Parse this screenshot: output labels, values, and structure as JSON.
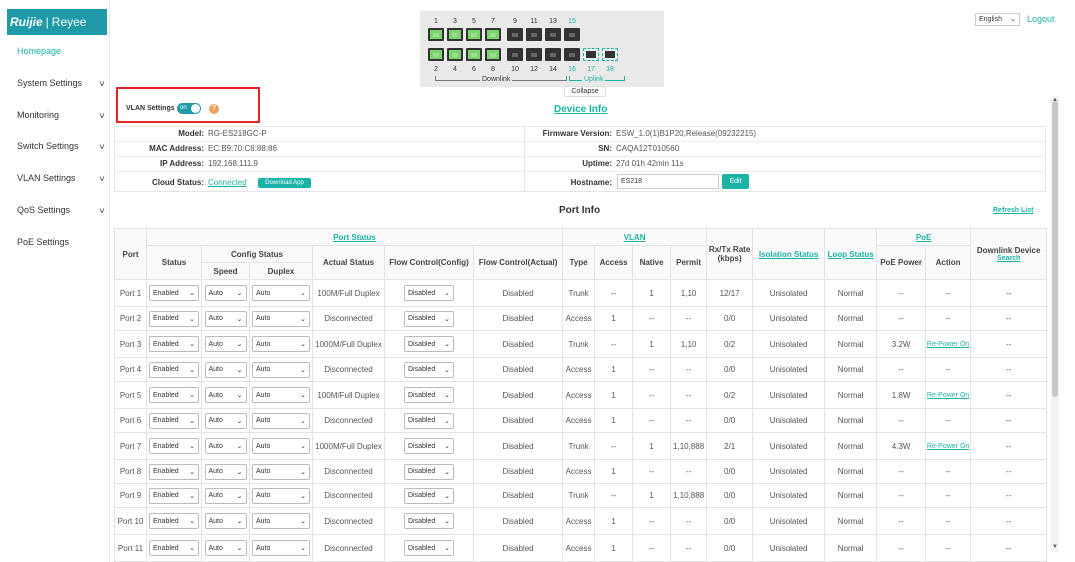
{
  "brand": {
    "logo_left": "Ruijie",
    "logo_right": "Reyee"
  },
  "sidebar": {
    "items": [
      {
        "label": "Homepage",
        "has_chevron": false,
        "active": true
      },
      {
        "label": "System Settings",
        "has_chevron": true
      },
      {
        "label": "Monitoring",
        "has_chevron": true
      },
      {
        "label": "Switch Settings",
        "has_chevron": true
      },
      {
        "label": "VLAN Settings",
        "has_chevron": true
      },
      {
        "label": "QoS Settings",
        "has_chevron": true
      },
      {
        "label": "PoE Settings",
        "has_chevron": false
      }
    ]
  },
  "panel": {
    "top_numbers": [
      "1",
      "3",
      "5",
      "7",
      "9",
      "11",
      "13",
      "15"
    ],
    "bottom_numbers": [
      "2",
      "4",
      "6",
      "8",
      "10",
      "12",
      "14",
      "16",
      "17",
      "18"
    ],
    "downlink_label": "Downlink",
    "uplink_label": "Uplink",
    "collapse_label": "Collapse"
  },
  "header": {
    "language": "English",
    "logout": "Logout"
  },
  "vlan": {
    "label": "VLAN Settings",
    "toggle": "on",
    "help": "?"
  },
  "device": {
    "title": "Device Info",
    "model_k": "Model:",
    "model": "RG-ES218GC-P",
    "mac_k": "MAC Address:",
    "mac": "EC:B9:70:C6:88:86",
    "ip_k": "IP Address:",
    "ip": "192.168.111.9",
    "cloud_k": "Cloud Status:",
    "cloud": "Connected",
    "download": "Download App",
    "fw_k": "Firmware Version:",
    "fw": "ESW_1.0(1)B1P20,Release(09232215)",
    "sn_k": "SN:",
    "sn": "CAQA12T010560",
    "uptime_k": "Uptime:",
    "uptime": "27d 01h 42min 11s",
    "host_k": "Hostname:",
    "host": "ES218",
    "edit": "Edit"
  },
  "port_info": {
    "title": "Port Info",
    "refresh": "Refresh List",
    "headers": {
      "port": "Port",
      "port_status": "Port Status",
      "status": "Status",
      "config_status": "Config Status",
      "speed": "Speed",
      "duplex": "Duplex",
      "actual_status": "Actual Status",
      "flow_config": "Flow Control(Config)",
      "flow_actual": "Flow Control(Actual)",
      "vlan": "VLAN",
      "type": "Type",
      "access": "Access",
      "native": "Native",
      "permit": "Permit",
      "rxtx": "Rx/Tx Rate (kbps)",
      "isolation": "Isolation Status",
      "loop": "Loop Status",
      "poe": "PoE",
      "poe_power": "PoE Power",
      "action": "Action",
      "downlink": "Downlink Device",
      "search": "Search"
    },
    "rows": [
      {
        "port": "Port 1",
        "status": "Enabled",
        "speed": "Auto",
        "duplex": "Auto",
        "actual": "100M/Full Duplex",
        "actual_link": true,
        "flow_cfg": "Disabled",
        "flow_act": "Disabled",
        "type": "Trunk",
        "access": "--",
        "native": "1",
        "permit": "1,10",
        "rate": "12/17",
        "iso": "Unisolated",
        "loop": "Normal",
        "power": "--",
        "action": "--",
        "action_link": false,
        "dev": "--"
      },
      {
        "port": "Port 2",
        "status": "Enabled",
        "speed": "Auto",
        "duplex": "Auto",
        "actual": "Disconnected",
        "actual_link": false,
        "flow_cfg": "Disabled",
        "flow_act": "Disabled",
        "type": "Access",
        "access": "1",
        "native": "--",
        "permit": "--",
        "rate": "0/0",
        "iso": "Unisolated",
        "loop": "Normal",
        "power": "--",
        "action": "--",
        "action_link": false,
        "dev": "--"
      },
      {
        "port": "Port 3",
        "status": "Enabled",
        "speed": "Auto",
        "duplex": "Auto",
        "actual": "1000M/Full Duplex",
        "actual_link": true,
        "flow_cfg": "Disabled",
        "flow_act": "Disabled",
        "type": "Trunk",
        "access": "--",
        "native": "1",
        "permit": "1,10",
        "rate": "0/2",
        "iso": "Unisolated",
        "loop": "Normal",
        "power": "3.2W",
        "action": "Re-Power On",
        "action_link": true,
        "dev": "--"
      },
      {
        "port": "Port 4",
        "status": "Enabled",
        "speed": "Auto",
        "duplex": "Auto",
        "actual": "Disconnected",
        "actual_link": false,
        "flow_cfg": "Disabled",
        "flow_act": "Disabled",
        "type": "Access",
        "access": "1",
        "native": "--",
        "permit": "--",
        "rate": "0/0",
        "iso": "Unisolated",
        "loop": "Normal",
        "power": "--",
        "action": "--",
        "action_link": false,
        "dev": "--"
      },
      {
        "port": "Port 5",
        "status": "Enabled",
        "speed": "Auto",
        "duplex": "Auto",
        "actual": "100M/Full Duplex",
        "actual_link": true,
        "flow_cfg": "Disabled",
        "flow_act": "Disabled",
        "type": "Access",
        "access": "1",
        "native": "--",
        "permit": "--",
        "rate": "0/2",
        "iso": "Unisolated",
        "loop": "Normal",
        "power": "1.8W",
        "action": "Re-Power On",
        "action_link": true,
        "dev": "--"
      },
      {
        "port": "Port 6",
        "status": "Enabled",
        "speed": "Auto",
        "duplex": "Auto",
        "actual": "Disconnected",
        "actual_link": false,
        "flow_cfg": "Disabled",
        "flow_act": "Disabled",
        "type": "Access",
        "access": "1",
        "native": "--",
        "permit": "--",
        "rate": "0/0",
        "iso": "Unisolated",
        "loop": "Normal",
        "power": "--",
        "action": "--",
        "action_link": false,
        "dev": "--"
      },
      {
        "port": "Port 7",
        "status": "Enabled",
        "speed": "Auto",
        "duplex": "Auto",
        "actual": "1000M/Full Duplex",
        "actual_link": true,
        "flow_cfg": "Disabled",
        "flow_act": "Disabled",
        "type": "Trunk",
        "access": "--",
        "native": "1",
        "permit": "1,10,888",
        "rate": "2/1",
        "iso": "Unisolated",
        "loop": "Normal",
        "power": "4.3W",
        "action": "Re-Power On",
        "action_link": true,
        "dev": "--"
      },
      {
        "port": "Port 8",
        "status": "Enabled",
        "speed": "Auto",
        "duplex": "Auto",
        "actual": "Disconnected",
        "actual_link": false,
        "flow_cfg": "Disabled",
        "flow_act": "Disabled",
        "type": "Access",
        "access": "1",
        "native": "--",
        "permit": "--",
        "rate": "0/0",
        "iso": "Unisolated",
        "loop": "Normal",
        "power": "--",
        "action": "--",
        "action_link": false,
        "dev": "--"
      },
      {
        "port": "Port 9",
        "status": "Enabled",
        "speed": "Auto",
        "duplex": "Auto",
        "actual": "Disconnected",
        "actual_link": false,
        "flow_cfg": "Disabled",
        "flow_act": "Disabled",
        "type": "Trunk",
        "access": "--",
        "native": "1",
        "permit": "1,10,888",
        "rate": "0/0",
        "iso": "Unisolated",
        "loop": "Normal",
        "power": "--",
        "action": "--",
        "action_link": false,
        "dev": "--"
      },
      {
        "port": "Port 10",
        "status": "Enabled",
        "speed": "Auto",
        "duplex": "Auto",
        "actual": "Disconnected",
        "actual_link": false,
        "flow_cfg": "Disabled",
        "flow_act": "Disabled",
        "type": "Access",
        "access": "1",
        "native": "--",
        "permit": "--",
        "rate": "0/0",
        "iso": "Unisolated",
        "loop": "Normal",
        "power": "--",
        "action": "--",
        "action_link": false,
        "dev": "--"
      },
      {
        "port": "Port 11",
        "status": "Enabled",
        "speed": "Auto",
        "duplex": "Auto",
        "actual": "Disconnected",
        "actual_link": false,
        "flow_cfg": "Disabled",
        "flow_act": "Disabled",
        "type": "Access",
        "access": "1",
        "native": "--",
        "permit": "--",
        "rate": "0/0",
        "iso": "Unisolated",
        "loop": "Normal",
        "power": "--",
        "action": "--",
        "action_link": false,
        "dev": "--"
      }
    ]
  },
  "colors": {
    "accent": "#1bb3a6",
    "highlight": "#e02424",
    "link_up": "#7bd36b"
  }
}
